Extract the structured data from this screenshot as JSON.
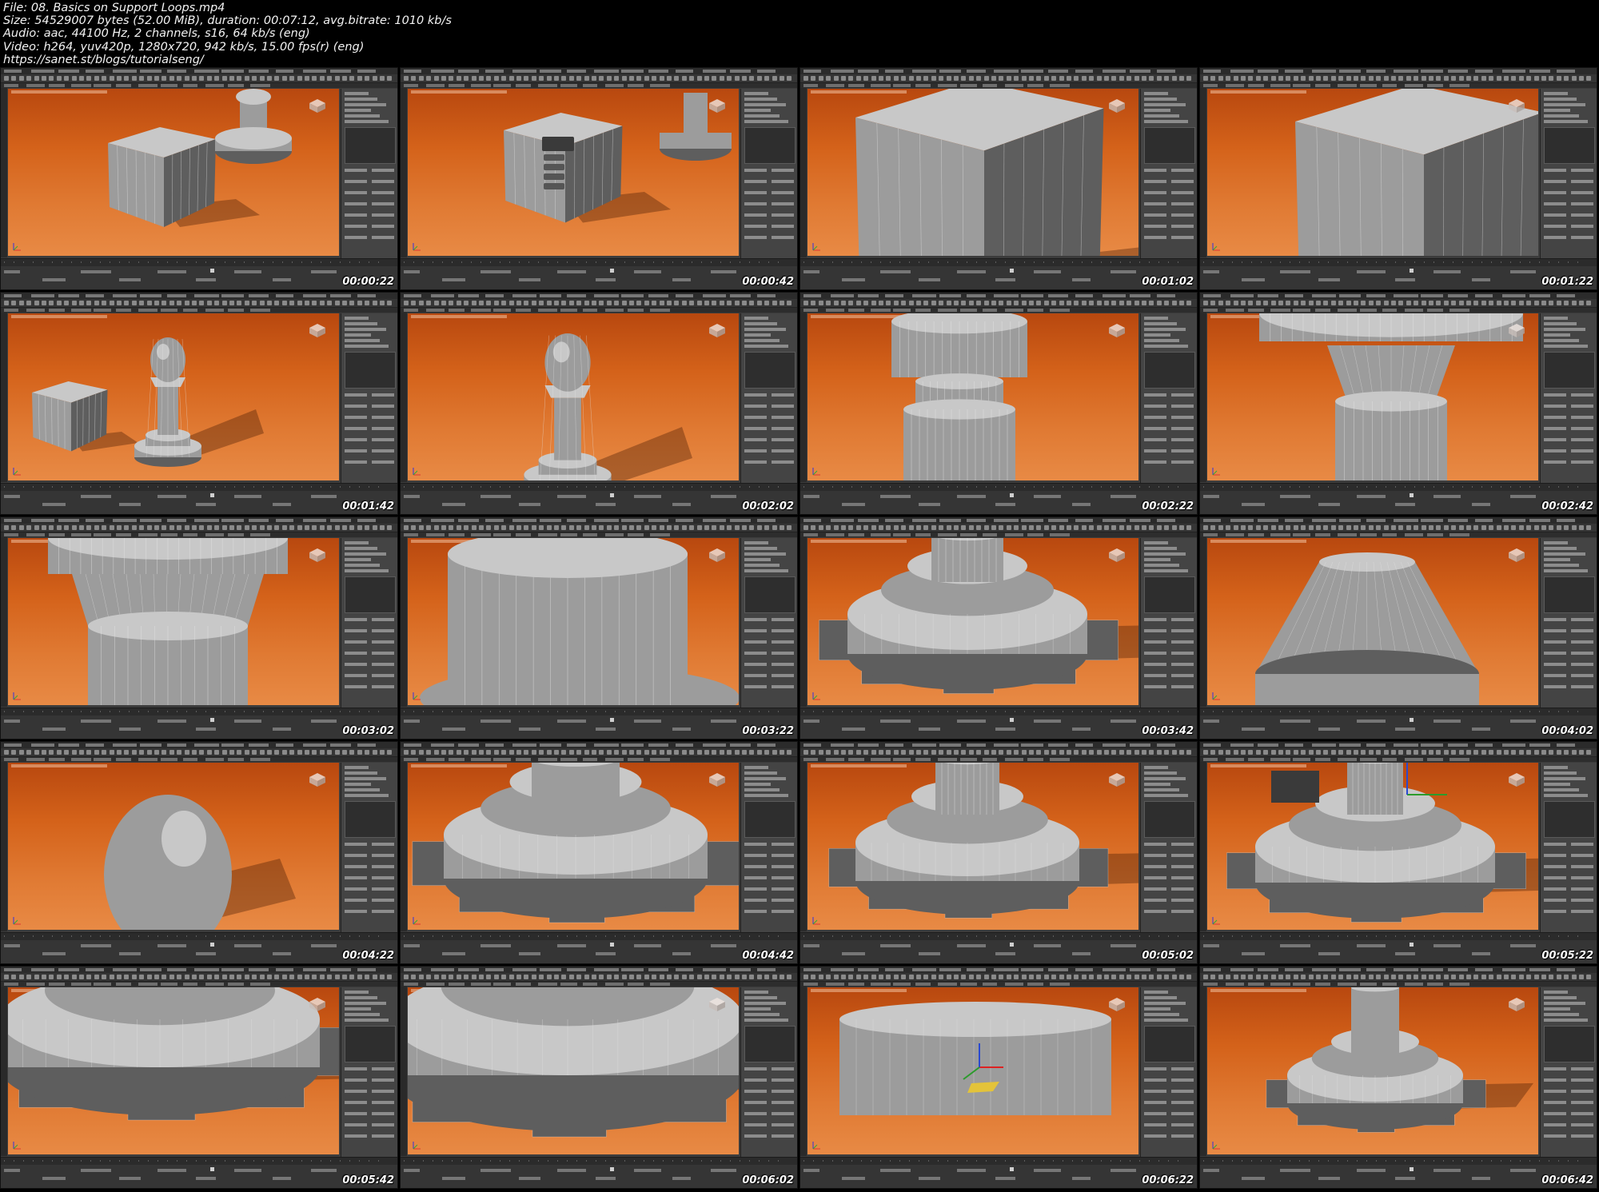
{
  "header": {
    "lines": [
      "File: 08. Basics on Support Loops.mp4",
      "Size: 54529007 bytes (52.00 MiB), duration: 00:07:12, avg.bitrate: 1010 kb/s",
      "Audio: aac, 44100 Hz, 2 channels, s16, 64 kb/s (eng)",
      "Video: h264, yuv420p, 1280x720, 942 kb/s, 15.00 fps(r) (eng)",
      "https://sanet.st/blogs/tutorialseng/"
    ]
  },
  "thumbnails": [
    {
      "timestamp": "00:00:22",
      "scene": "cube-and-pawn"
    },
    {
      "timestamp": "00:00:42",
      "scene": "cube-dialog"
    },
    {
      "timestamp": "00:01:02",
      "scene": "cube-close"
    },
    {
      "timestamp": "00:01:22",
      "scene": "cube-smooth"
    },
    {
      "timestamp": "00:01:42",
      "scene": "pawn-full"
    },
    {
      "timestamp": "00:02:02",
      "scene": "pawn-smooth"
    },
    {
      "timestamp": "00:02:22",
      "scene": "neck-close"
    },
    {
      "timestamp": "00:02:42",
      "scene": "neck-close-2"
    },
    {
      "timestamp": "00:03:02",
      "scene": "neck-mesh"
    },
    {
      "timestamp": "00:03:22",
      "scene": "cylinder-close"
    },
    {
      "timestamp": "00:03:42",
      "scene": "base-gear"
    },
    {
      "timestamp": "00:04:02",
      "scene": "cone-top"
    },
    {
      "timestamp": "00:04:22",
      "scene": "egg"
    },
    {
      "timestamp": "00:04:42",
      "scene": "base-smooth"
    },
    {
      "timestamp": "00:05:02",
      "scene": "base-gear-2"
    },
    {
      "timestamp": "00:05:22",
      "scene": "base-quad"
    },
    {
      "timestamp": "00:05:42",
      "scene": "base-gear-close"
    },
    {
      "timestamp": "00:06:02",
      "scene": "base-smooth-close"
    },
    {
      "timestamp": "00:06:22",
      "scene": "base-edge-gizmo"
    },
    {
      "timestamp": "00:06:42",
      "scene": "base-final"
    }
  ],
  "colors": {
    "viewport_orange": "#d4621a",
    "ui_dark": "#3c3c3c",
    "mesh_gray": "#9a9a9a"
  },
  "icons": [
    "play-icon",
    "view-cube-icon",
    "axis-tripod-icon"
  ]
}
